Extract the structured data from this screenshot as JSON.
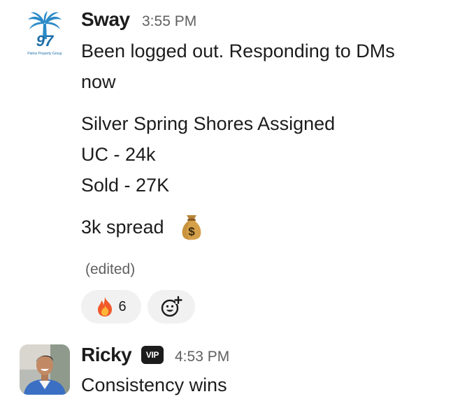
{
  "messages": [
    {
      "author": "Sway",
      "time": "3:55 PM",
      "avatar_logo_text": "97",
      "avatar_caption": "Palms Property Group",
      "lines": [
        "Been logged out. Responding to DMs",
        "now",
        "Silver Spring Shores Assigned",
        "UC - 24k",
        "Sold - 27K",
        "3k spread"
      ],
      "inline_emoji": "money-bag-icon",
      "edited_label": "(edited)",
      "reactions": [
        {
          "emoji": "fire-icon",
          "count": "6"
        }
      ],
      "add_reaction_icon": "add-reaction-icon"
    },
    {
      "author": "Ricky",
      "badge": "VIP",
      "time": "4:53 PM",
      "lines": [
        "Consistency wins"
      ]
    }
  ],
  "colors": {
    "text": "#1d1c1d",
    "muted": "#616061",
    "reaction_bg": "#f1f1f1",
    "logo_blue": "#2a8ac7"
  }
}
